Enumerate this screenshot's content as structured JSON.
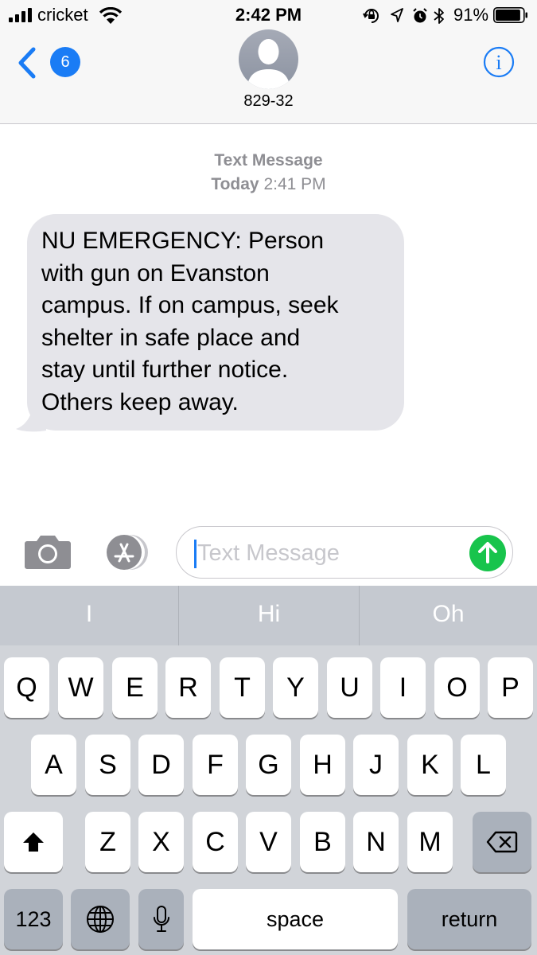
{
  "status_bar": {
    "carrier": "cricket",
    "time": "2:42 PM",
    "battery_percent": "91%",
    "battery_level": 0.91,
    "icons": [
      "signal-icon",
      "wifi-icon",
      "orientation-lock-icon",
      "location-icon",
      "alarm-icon",
      "bluetooth-icon",
      "battery-icon"
    ]
  },
  "header": {
    "back_badge": "6",
    "contact_name": "829-32",
    "accent_color": "#1a7cf5"
  },
  "conversation": {
    "message_type": "Text Message",
    "date_label": "Today",
    "time_label": "2:41 PM",
    "messages": [
      {
        "direction": "incoming",
        "text": "NU EMERGENCY: Person\nwith gun on Evanston\ncampus. If on campus, seek\nshelter in safe place and\nstay until further notice.\nOthers keep away."
      }
    ]
  },
  "composer": {
    "placeholder": "Text Message",
    "value": "",
    "send_color": "#18c44c"
  },
  "keyboard": {
    "suggestions": [
      "I",
      "Hi",
      "Oh"
    ],
    "row1": [
      "Q",
      "W",
      "E",
      "R",
      "T",
      "Y",
      "U",
      "I",
      "O",
      "P"
    ],
    "row2": [
      "A",
      "S",
      "D",
      "F",
      "G",
      "H",
      "J",
      "K",
      "L"
    ],
    "row3": [
      "Z",
      "X",
      "C",
      "V",
      "B",
      "N",
      "M"
    ],
    "numbers_label": "123",
    "space_label": "space",
    "return_label": "return"
  }
}
